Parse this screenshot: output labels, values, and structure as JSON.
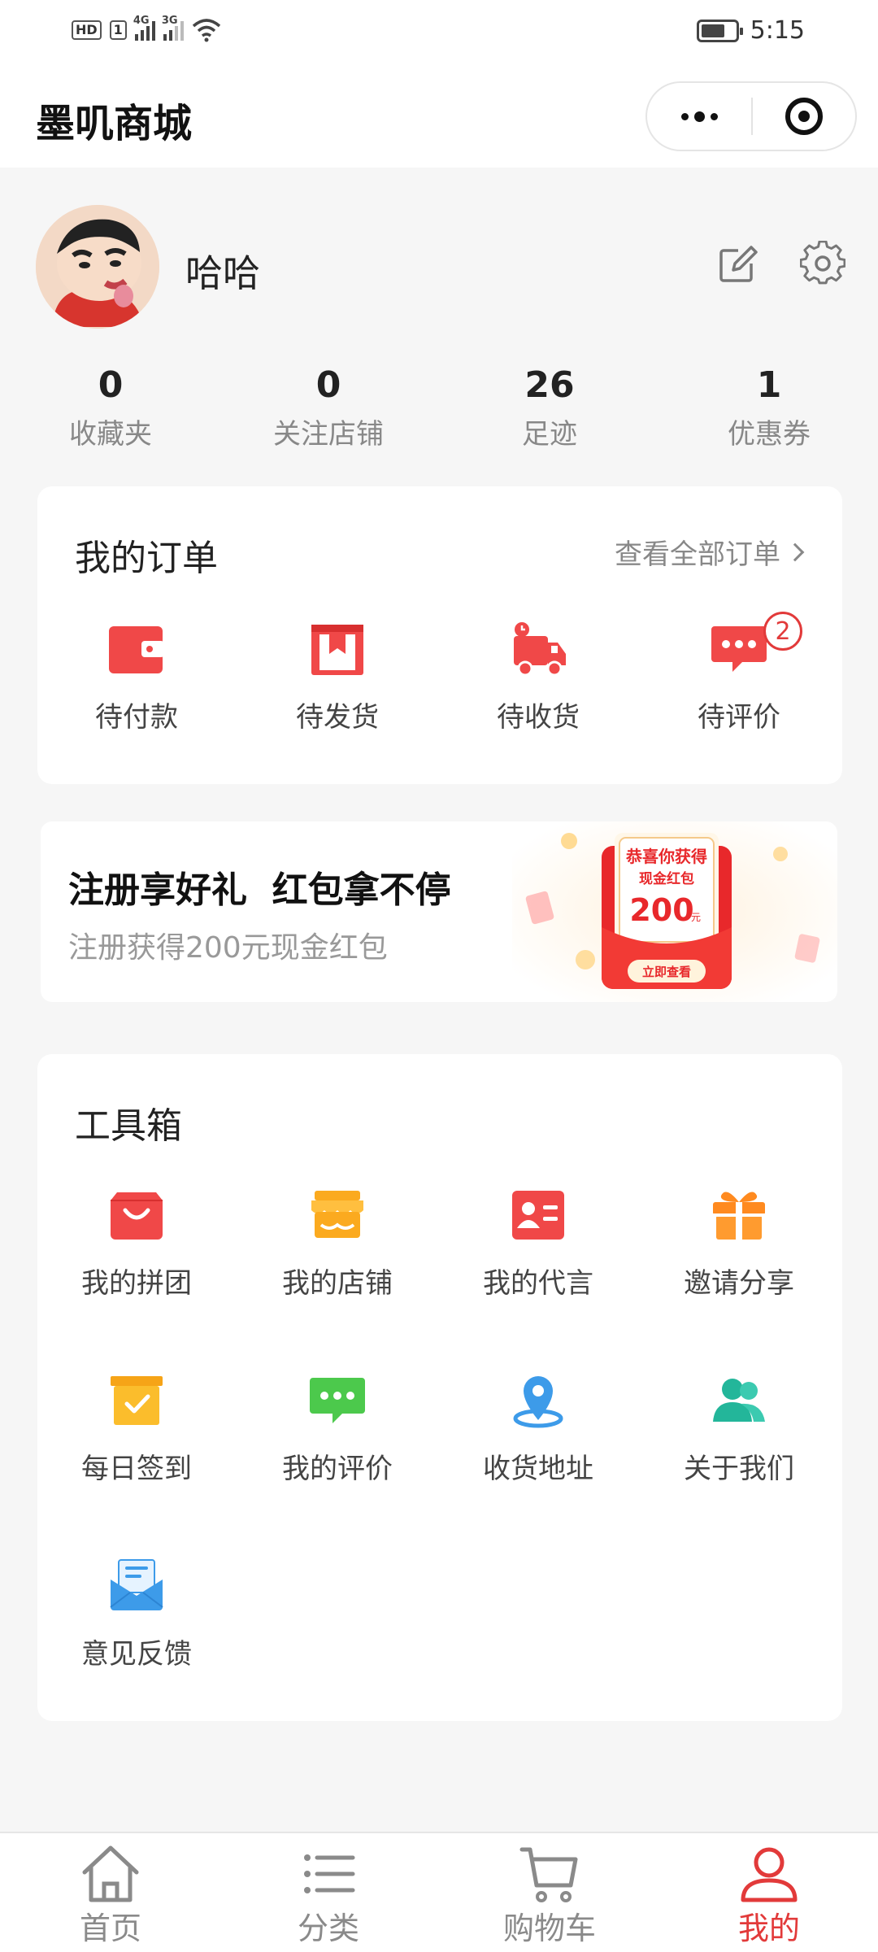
{
  "status_bar": {
    "time": "5:15",
    "hd_label": "HD",
    "sim_label": "1",
    "net1": "4G",
    "net2": "3G"
  },
  "header": {
    "title": "墨叽商城"
  },
  "profile": {
    "username": "哈哈"
  },
  "stats": [
    {
      "value": "0",
      "label": "收藏夹"
    },
    {
      "value": "0",
      "label": "关注店铺"
    },
    {
      "value": "26",
      "label": "足迹"
    },
    {
      "value": "1",
      "label": "优惠券"
    }
  ],
  "orders": {
    "title": "我的订单",
    "view_all": "查看全部订单",
    "items": [
      {
        "label": "待付款",
        "icon": "wallet-icon"
      },
      {
        "label": "待发货",
        "icon": "package-icon"
      },
      {
        "label": "待收货",
        "icon": "delivery-truck-icon"
      },
      {
        "label": "待评价",
        "icon": "comment-icon",
        "badge": "2"
      }
    ]
  },
  "banner": {
    "title": "注册享好礼  红包拿不停",
    "subtitle": "注册获得200元现金红包",
    "art_line1": "恭喜你获得",
    "art_line2": "现金红包",
    "art_amount": "200",
    "art_unit": "元",
    "art_button": "立即查看"
  },
  "toolbox": {
    "title": "工具箱",
    "items": [
      {
        "label": "我的拼团",
        "icon": "shopping-bag-icon"
      },
      {
        "label": "我的店铺",
        "icon": "storefront-icon"
      },
      {
        "label": "我的代言",
        "icon": "id-card-icon"
      },
      {
        "label": "邀请分享",
        "icon": "gift-icon"
      },
      {
        "label": "每日签到",
        "icon": "checkin-box-icon"
      },
      {
        "label": "我的评价",
        "icon": "chat-bubble-icon"
      },
      {
        "label": "收货地址",
        "icon": "location-pin-icon"
      },
      {
        "label": "关于我们",
        "icon": "people-icon"
      },
      {
        "label": "意见反馈",
        "icon": "feedback-mail-icon"
      }
    ]
  },
  "tabbar": {
    "items": [
      {
        "label": "首页",
        "icon": "home-icon",
        "active": false
      },
      {
        "label": "分类",
        "icon": "category-list-icon",
        "active": false
      },
      {
        "label": "购物车",
        "icon": "cart-icon",
        "active": false
      },
      {
        "label": "我的",
        "icon": "user-icon",
        "active": true
      }
    ]
  },
  "colors": {
    "accent": "#e23a3a",
    "icon_red": "#f04848",
    "icon_orange": "#fbaa1f",
    "icon_green": "#4cc94c",
    "icon_blue": "#3d9be9",
    "icon_teal": "#23b69a",
    "background": "#f6f6f6"
  }
}
